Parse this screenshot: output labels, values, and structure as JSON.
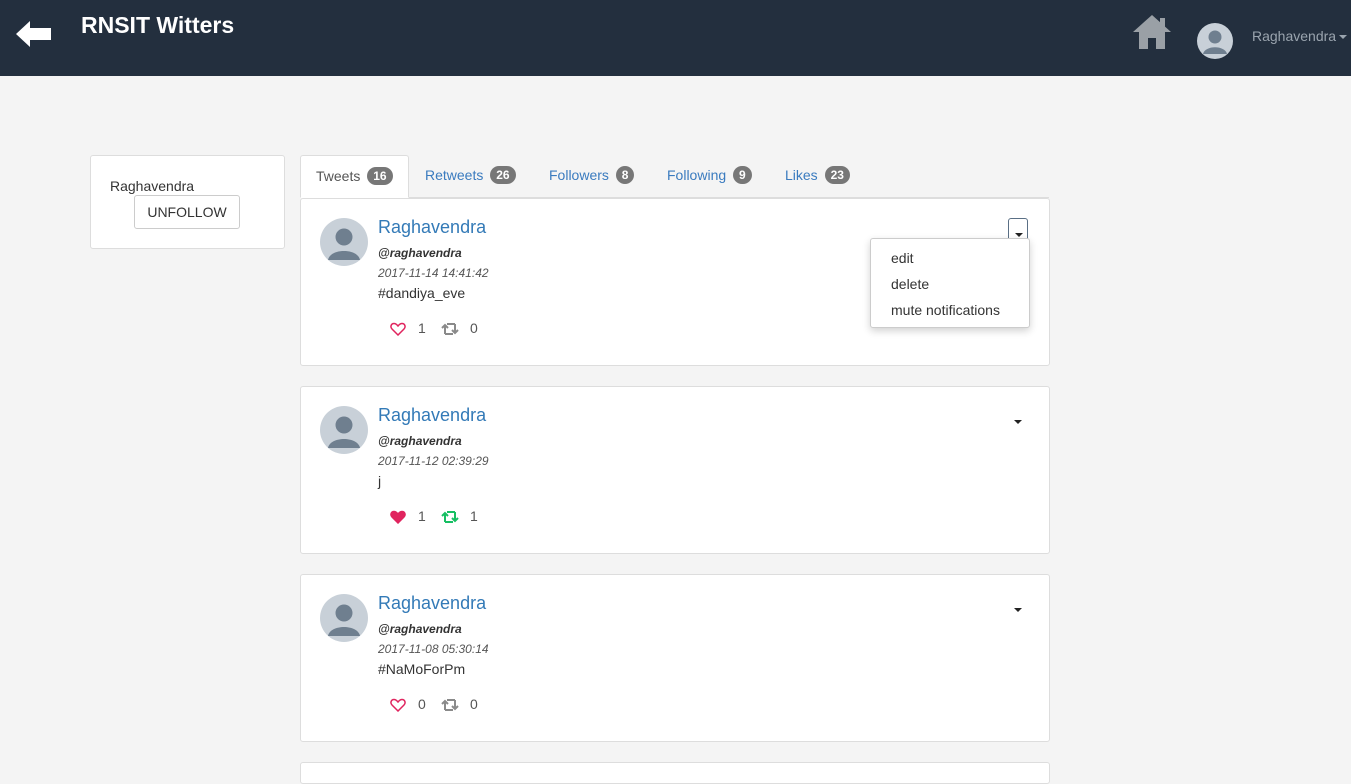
{
  "header": {
    "title": "RNSIT Witters",
    "user_name": "Raghavendra"
  },
  "profile": {
    "name": "Raghavendra",
    "unfollow_label": "UNFOLLOW"
  },
  "tabs": [
    {
      "label": "Tweets",
      "count": "16",
      "active": true
    },
    {
      "label": "Retweets",
      "count": "26"
    },
    {
      "label": "Followers",
      "count": "8"
    },
    {
      "label": "Following",
      "count": "9"
    },
    {
      "label": "Likes",
      "count": "23"
    }
  ],
  "tweets": [
    {
      "name": "Raghavendra",
      "handle": "@raghavendra",
      "time": "2017-11-14 14:41:42",
      "text": "#dandiya_eve",
      "likes": "1",
      "retweets": "0",
      "liked": false,
      "retweeted": false
    },
    {
      "name": "Raghavendra",
      "handle": "@raghavendra",
      "time": "2017-11-12 02:39:29",
      "text": "j",
      "likes": "1",
      "retweets": "1",
      "liked": true,
      "retweeted": true
    },
    {
      "name": "Raghavendra",
      "handle": "@raghavendra",
      "time": "2017-11-08 05:30:14",
      "text": "#NaMoForPm",
      "likes": "0",
      "retweets": "0",
      "liked": false,
      "retweeted": false
    }
  ],
  "dropdown_menu": {
    "edit": "edit",
    "delete": "delete",
    "mute": "mute notifications"
  },
  "colors": {
    "topbar": "#232f3e",
    "link": "#337ab7",
    "like": "#e0245e",
    "retweet": "#17bf63"
  }
}
